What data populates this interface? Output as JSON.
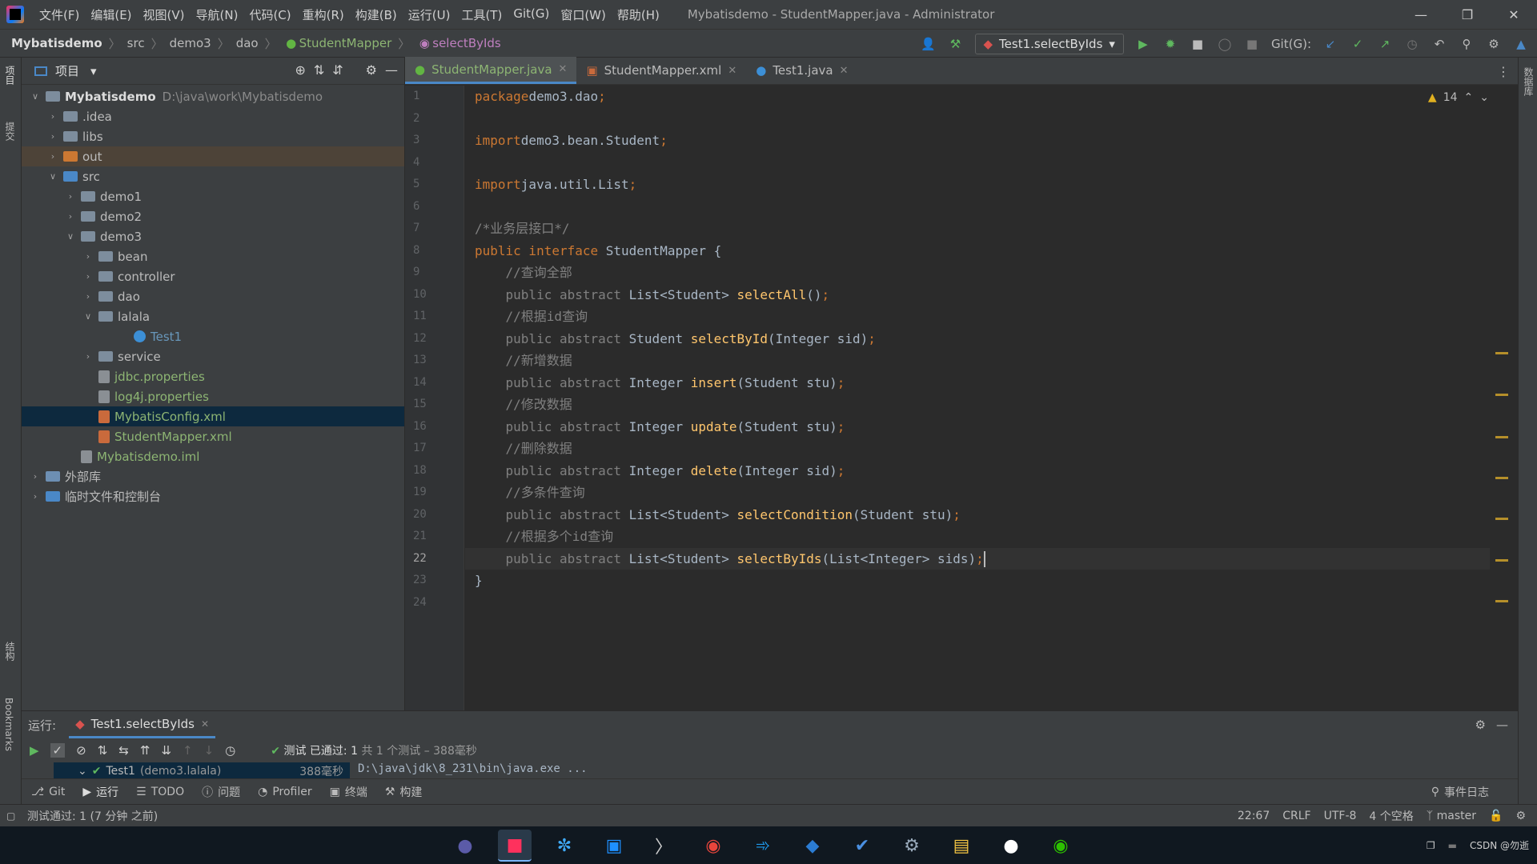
{
  "menu": {
    "items": [
      "文件(F)",
      "编辑(E)",
      "视图(V)",
      "导航(N)",
      "代码(C)",
      "重构(R)",
      "构建(B)",
      "运行(U)",
      "工具(T)",
      "Git(G)",
      "窗口(W)",
      "帮助(H)"
    ],
    "window_title": "Mybatisdemo - StudentMapper.java - Administrator"
  },
  "breadcrumb": [
    "Mybatisdemo",
    "src",
    "demo3",
    "dao",
    "StudentMapper",
    "selectByIds"
  ],
  "toolbar": {
    "run_config": "Test1.selectByIds",
    "git_label": "Git(G):"
  },
  "left_strip": {
    "project": "项目",
    "commit": "提交",
    "structure": "结构",
    "bookmarks": "Bookmarks"
  },
  "right_strip": {
    "database": "数据库"
  },
  "project_panel": {
    "title": "项目",
    "root_path": "D:\\java\\work\\Mybatisdemo",
    "tree": [
      {
        "label": "Mybatisdemo",
        "indent": 0,
        "arrow": "down",
        "icon": "module-folder-icon"
      },
      {
        "label": ".idea",
        "indent": 1,
        "arrow": "right",
        "icon": "folder-icon"
      },
      {
        "label": "libs",
        "indent": 1,
        "arrow": "right",
        "icon": "folder-icon"
      },
      {
        "label": "out",
        "indent": 1,
        "arrow": "right",
        "icon": "folder-orange-icon",
        "highlight": true
      },
      {
        "label": "src",
        "indent": 1,
        "arrow": "down",
        "icon": "folder-blue-icon"
      },
      {
        "label": "demo1",
        "indent": 2,
        "arrow": "right",
        "icon": "package-icon"
      },
      {
        "label": "demo2",
        "indent": 2,
        "arrow": "right",
        "icon": "package-icon"
      },
      {
        "label": "demo3",
        "indent": 2,
        "arrow": "down",
        "icon": "package-icon"
      },
      {
        "label": "bean",
        "indent": 3,
        "arrow": "right",
        "icon": "package-icon"
      },
      {
        "label": "controller",
        "indent": 3,
        "arrow": "right",
        "icon": "package-icon"
      },
      {
        "label": "dao",
        "indent": 3,
        "arrow": "right",
        "icon": "package-icon"
      },
      {
        "label": "lalala",
        "indent": 3,
        "arrow": "down",
        "icon": "package-icon"
      },
      {
        "label": "Test1",
        "indent": 5,
        "arrow": "",
        "icon": "class-icon",
        "color": "blue"
      },
      {
        "label": "service",
        "indent": 3,
        "arrow": "right",
        "icon": "package-icon"
      },
      {
        "label": "jdbc.properties",
        "indent": 3,
        "arrow": "",
        "icon": "properties-file-icon",
        "color": "green"
      },
      {
        "label": "log4j.properties",
        "indent": 3,
        "arrow": "",
        "icon": "properties-file-icon",
        "color": "green"
      },
      {
        "label": "MybatisConfig.xml",
        "indent": 3,
        "arrow": "",
        "icon": "xml-file-icon",
        "color": "green",
        "selected": true
      },
      {
        "label": "StudentMapper.xml",
        "indent": 3,
        "arrow": "",
        "icon": "xml-file-icon",
        "color": "green"
      },
      {
        "label": "Mybatisdemo.iml",
        "indent": 2,
        "arrow": "",
        "icon": "iml-file-icon",
        "color": "green"
      },
      {
        "label": "外部库",
        "indent": 0,
        "arrow": "right",
        "icon": "library-icon"
      },
      {
        "label": "临时文件和控制台",
        "indent": 0,
        "arrow": "right",
        "icon": "scratch-icon"
      }
    ]
  },
  "editor": {
    "tabs": [
      {
        "label": "StudentMapper.java",
        "active": true,
        "icon": "interface-icon"
      },
      {
        "label": "StudentMapper.xml",
        "active": false,
        "icon": "xml-file-icon"
      },
      {
        "label": "Test1.java",
        "active": false,
        "icon": "class-icon"
      }
    ],
    "warnings_count": "14",
    "current_line": 22,
    "lines": [
      [
        [
          "kw",
          "package"
        ],
        [
          "",
          "demo3.dao"
        ],
        [
          "kw",
          ";"
        ]
      ],
      [],
      [
        [
          "kw",
          "import"
        ],
        [
          "",
          "demo3.bean.Student"
        ],
        [
          "kw",
          ";"
        ]
      ],
      [],
      [
        [
          "kw",
          "import"
        ],
        [
          "",
          "java.util.List"
        ],
        [
          "kw",
          ";"
        ]
      ],
      [],
      [
        [
          "cm",
          "/*业务层接口*/"
        ]
      ],
      [
        [
          "kw",
          "public interface "
        ],
        [
          "",
          "StudentMapper {"
        ]
      ],
      [
        [
          "cm",
          "    //查询全部"
        ]
      ],
      [
        [
          "cm",
          "    public abstract "
        ],
        [
          "",
          "List<Student> "
        ],
        [
          "fn",
          "selectAll"
        ],
        [
          "",
          "()"
        ],
        [
          "kw",
          ";"
        ]
      ],
      [
        [
          "cm",
          "    //根据id查询"
        ]
      ],
      [
        [
          "cm",
          "    public abstract "
        ],
        [
          "",
          "Student "
        ],
        [
          "fn",
          "selectById"
        ],
        [
          "",
          "(Integer sid)"
        ],
        [
          "kw",
          ";"
        ]
      ],
      [
        [
          "cm",
          "    //新增数据"
        ]
      ],
      [
        [
          "cm",
          "    public abstract "
        ],
        [
          "",
          "Integer "
        ],
        [
          "fn",
          "insert"
        ],
        [
          "",
          "(Student stu)"
        ],
        [
          "kw",
          ";"
        ]
      ],
      [
        [
          "cm",
          "    //修改数据"
        ]
      ],
      [
        [
          "cm",
          "    public abstract "
        ],
        [
          "",
          "Integer "
        ],
        [
          "fn",
          "update"
        ],
        [
          "",
          "(Student stu)"
        ],
        [
          "kw",
          ";"
        ]
      ],
      [
        [
          "cm",
          "    //删除数据"
        ]
      ],
      [
        [
          "cm",
          "    public abstract "
        ],
        [
          "",
          "Integer "
        ],
        [
          "fn",
          "delete"
        ],
        [
          "",
          "(Integer sid)"
        ],
        [
          "kw",
          ";"
        ]
      ],
      [
        [
          "cm",
          "    //多条件查询"
        ]
      ],
      [
        [
          "cm",
          "    public abstract "
        ],
        [
          "",
          "List<Student> "
        ],
        [
          "fn",
          "selectCondition"
        ],
        [
          "",
          "(Student stu)"
        ],
        [
          "kw",
          ";"
        ]
      ],
      [
        [
          "cm",
          "    //根据多个id查询"
        ]
      ],
      [
        [
          "cm",
          "    public abstract "
        ],
        [
          "",
          "List<Student> "
        ],
        [
          "fn",
          "selectByIds"
        ],
        [
          "",
          "(List<Integer> sids)"
        ],
        [
          "kw",
          ";"
        ]
      ],
      [
        [
          "",
          "}"
        ]
      ],
      []
    ]
  },
  "run_panel": {
    "label": "运行:",
    "tab": "Test1.selectByIds",
    "status_prefix": "测试",
    "status_passed": "已通过: 1",
    "status_detail": "共 1 个测试 – 388毫秒",
    "tree_item": "Test1",
    "tree_item_pkg": "(demo3.lalala)",
    "tree_item_time": "388毫秒",
    "console_line": "D:\\java\\jdk\\8_231\\bin\\java.exe ..."
  },
  "bottom_tabs": [
    "Git",
    "运行",
    "TODO",
    "问题",
    "Profiler",
    "终端",
    "构建"
  ],
  "event_log": "事件日志",
  "status_bar": {
    "message": "测试通过: 1 (7 分钟 之前)",
    "position": "22:67",
    "line_sep": "CRLF",
    "encoding": "UTF-8",
    "indent": "4 个空格",
    "branch": "master"
  },
  "taskbar": {
    "watermark": "CSDN @勿逝"
  },
  "colors": {
    "keyword": "#cc7832",
    "function": "#ffc66d",
    "comment": "#808080",
    "text": "#a9b7c6",
    "accent": "#4a88c7",
    "green_file": "#8db573"
  }
}
